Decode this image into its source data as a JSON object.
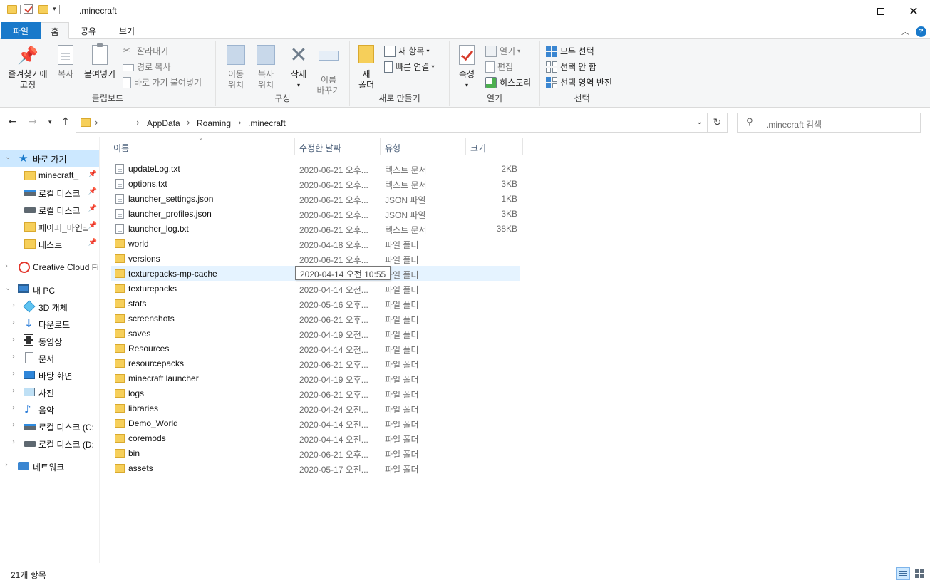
{
  "window": {
    "title": ".minecraft"
  },
  "tabs": {
    "file": "파일",
    "home": "홈",
    "share": "공유",
    "view": "보기"
  },
  "ribbon": {
    "clipboard": {
      "label": "클립보드",
      "pin": "즐겨찾기에\n고정",
      "copy": "복사",
      "paste": "붙여넣기",
      "cut": "잘라내기",
      "copy_path": "경로 복사",
      "paste_shortcut": "바로 가기 붙여넣기"
    },
    "organize": {
      "label": "구성",
      "move_to": "이동\n위치",
      "copy_to": "복사\n위치",
      "delete": "삭제",
      "rename": "이름\n바꾸기"
    },
    "new": {
      "label": "새로 만들기",
      "new_folder": "새\n폴더",
      "new_item": "새 항목",
      "easy_access": "빠른 연결"
    },
    "open": {
      "label": "열기",
      "properties": "속성",
      "open": "열기",
      "edit": "편집",
      "history": "히스토리"
    },
    "select": {
      "label": "선택",
      "select_all": "모두 선택",
      "select_none": "선택 안 함",
      "invert": "선택 영역 반전"
    }
  },
  "address": {
    "breadcrumbs": [
      "AppData",
      "Roaming",
      ".minecraft"
    ],
    "search_placeholder": ".minecraft 검색"
  },
  "nav": {
    "quick_access": "바로 가기",
    "items": [
      {
        "label": "minecraft_",
        "icon": "folder-icon",
        "pinned": true
      },
      {
        "label": "로컬 디스크",
        "icon": "drive-icon",
        "pinned": true
      },
      {
        "label": "로컬 디스크",
        "icon": "drive-icon",
        "pinned": true
      },
      {
        "label": "페이퍼_마인크",
        "icon": "folder-icon",
        "pinned": true
      },
      {
        "label": "테스트",
        "icon": "folder-icon",
        "pinned": true
      }
    ],
    "creative_cloud": "Creative Cloud Fi",
    "this_pc": "내 PC",
    "pc_items": [
      {
        "label": "3D 개체",
        "icon": "3d-objects-icon"
      },
      {
        "label": "다운로드",
        "icon": "downloads-icon"
      },
      {
        "label": "동영상",
        "icon": "videos-icon"
      },
      {
        "label": "문서",
        "icon": "documents-icon"
      },
      {
        "label": "바탕 화면",
        "icon": "desktop-icon"
      },
      {
        "label": "사진",
        "icon": "pictures-icon"
      },
      {
        "label": "음악",
        "icon": "music-icon"
      },
      {
        "label": "로컬 디스크 (C:",
        "icon": "system-drive-icon"
      },
      {
        "label": "로컬 디스크 (D:",
        "icon": "drive-icon"
      }
    ],
    "network": "네트워크"
  },
  "columns": {
    "name": "이름",
    "date": "수정한 날짜",
    "type": "유형",
    "size": "크기"
  },
  "files": [
    {
      "name": "updateLog.txt",
      "date": "2020-06-21 오후...",
      "type": "텍스트 문서",
      "size": "2KB",
      "kind": "text"
    },
    {
      "name": "options.txt",
      "date": "2020-06-21 오후...",
      "type": "텍스트 문서",
      "size": "3KB",
      "kind": "text"
    },
    {
      "name": "launcher_settings.json",
      "date": "2020-06-21 오후...",
      "type": "JSON 파일",
      "size": "1KB",
      "kind": "text"
    },
    {
      "name": "launcher_profiles.json",
      "date": "2020-06-21 오후...",
      "type": "JSON 파일",
      "size": "3KB",
      "kind": "text"
    },
    {
      "name": "launcher_log.txt",
      "date": "2020-06-21 오후...",
      "type": "텍스트 문서",
      "size": "38KB",
      "kind": "text"
    },
    {
      "name": "world",
      "date": "2020-04-18 오후...",
      "type": "파일 폴더",
      "size": "",
      "kind": "folder"
    },
    {
      "name": "versions",
      "date": "2020-06-21 오후...",
      "type": "파일 폴더",
      "size": "",
      "kind": "folder"
    },
    {
      "name": "texturepacks-mp-cache",
      "date": "2020-04-14 오전...",
      "type": "파일 폴더",
      "size": "",
      "kind": "folder"
    },
    {
      "name": "texturepacks",
      "date": "2020-04-14 오전...",
      "type": "파일 폴더",
      "size": "",
      "kind": "folder"
    },
    {
      "name": "stats",
      "date": "2020-05-16 오후...",
      "type": "파일 폴더",
      "size": "",
      "kind": "folder"
    },
    {
      "name": "screenshots",
      "date": "2020-06-21 오후...",
      "type": "파일 폴더",
      "size": "",
      "kind": "folder"
    },
    {
      "name": "saves",
      "date": "2020-04-19 오전...",
      "type": "파일 폴더",
      "size": "",
      "kind": "folder"
    },
    {
      "name": "Resources",
      "date": "2020-04-14 오전...",
      "type": "파일 폴더",
      "size": "",
      "kind": "folder"
    },
    {
      "name": "resourcepacks",
      "date": "2020-06-21 오후...",
      "type": "파일 폴더",
      "size": "",
      "kind": "folder"
    },
    {
      "name": "minecraft launcher",
      "date": "2020-04-19 오후...",
      "type": "파일 폴더",
      "size": "",
      "kind": "folder"
    },
    {
      "name": "logs",
      "date": "2020-06-21 오후...",
      "type": "파일 폴더",
      "size": "",
      "kind": "folder"
    },
    {
      "name": "libraries",
      "date": "2020-04-24 오전...",
      "type": "파일 폴더",
      "size": "",
      "kind": "folder"
    },
    {
      "name": "Demo_World",
      "date": "2020-04-14 오전...",
      "type": "파일 폴더",
      "size": "",
      "kind": "folder"
    },
    {
      "name": "coremods",
      "date": "2020-04-14 오전...",
      "type": "파일 폴더",
      "size": "",
      "kind": "folder"
    },
    {
      "name": "bin",
      "date": "2020-06-21 오후...",
      "type": "파일 폴더",
      "size": "",
      "kind": "folder"
    },
    {
      "name": "assets",
      "date": "2020-05-17 오전...",
      "type": "파일 폴더",
      "size": "",
      "kind": "folder"
    }
  ],
  "hover_index": 7,
  "tooltip": "2020-04-14 오전 10:55",
  "status": {
    "item_count": "21개 항목"
  },
  "colors": {
    "accent": "#1979ca",
    "selection": "#cce8ff",
    "hover": "#e5f3ff",
    "folder": "#f6cf5a"
  }
}
